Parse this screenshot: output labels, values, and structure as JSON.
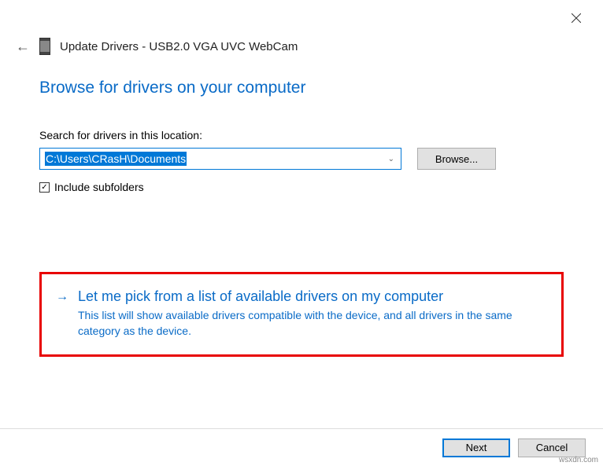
{
  "header": {
    "title": "Update Drivers - USB2.0 VGA UVC WebCam"
  },
  "main": {
    "heading": "Browse for drivers on your computer",
    "search_label": "Search for drivers in this location:",
    "path": "C:\\Users\\CRasH\\Documents",
    "browse_button": "Browse...",
    "include_subfolders": "Include subfolders"
  },
  "option": {
    "title": "Let me pick from a list of available drivers on my computer",
    "description": "This list will show available drivers compatible with the device, and all drivers in the same category as the device."
  },
  "footer": {
    "next": "Next",
    "cancel": "Cancel"
  },
  "watermark": "wsxdn.com"
}
